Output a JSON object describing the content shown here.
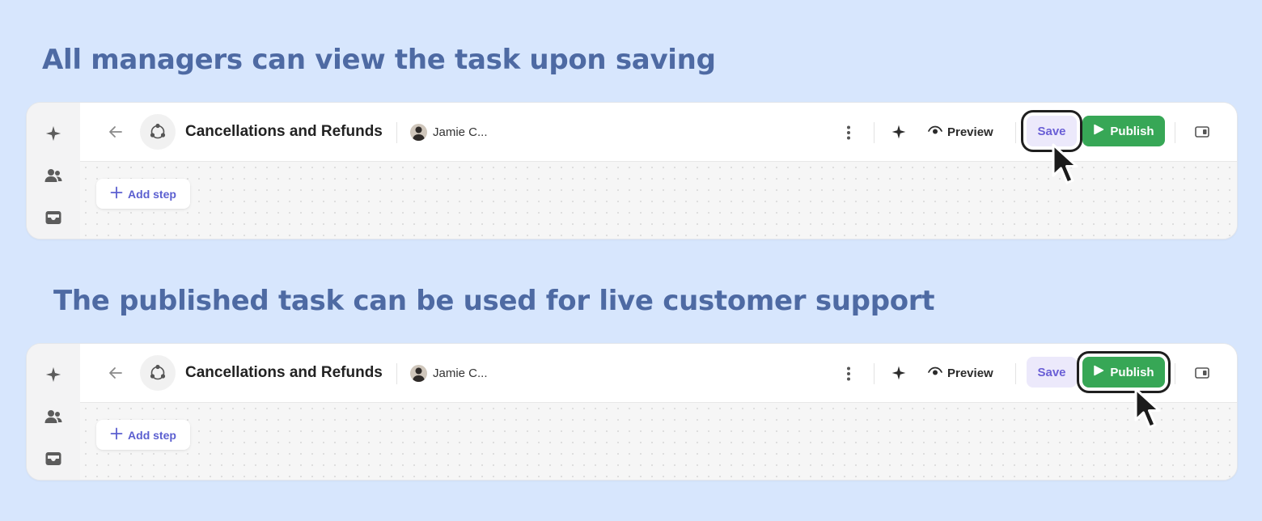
{
  "captions": [
    "All managers can view the task upon saving",
    "The published task can be used for live customer support"
  ],
  "editor": {
    "task_title": "Cancellations and Refunds",
    "owner_name": "Jamie C...",
    "preview_label": "Preview",
    "save_label": "Save",
    "publish_label": "Publish",
    "add_step_label": "Add step",
    "icons": {
      "rail": [
        "sparkle-icon",
        "users-icon",
        "inbox-icon"
      ],
      "toolbar": [
        "back-arrow-icon",
        "task-workflow-icon",
        "more-vertical-icon",
        "sparkle-icon",
        "eye-icon",
        "play-icon",
        "side-panel-icon"
      ]
    }
  },
  "colors": {
    "background": "#d7e6fd",
    "caption": "#4e6aa3",
    "save_bg": "#ece9fb",
    "save_text": "#6a5fd6",
    "publish_bg": "#37a756",
    "add_step_text": "#5b5fd0"
  }
}
